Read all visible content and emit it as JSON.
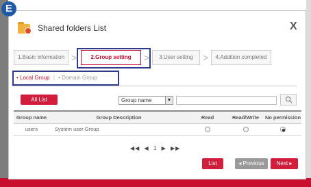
{
  "badge": "E",
  "dialog": {
    "title": "Shared folders List",
    "close": "X"
  },
  "steps": [
    {
      "label": "1.Basic information"
    },
    {
      "label": "2.Group setting"
    },
    {
      "label": "3.User setting"
    },
    {
      "label": "4.Addition completed"
    }
  ],
  "group_tabs": {
    "local": "• Local Group",
    "separator": "|",
    "domain": "• Domain Group"
  },
  "filter": {
    "all_list": "All List",
    "select_value": "Group name",
    "search_value": ""
  },
  "table": {
    "headers": [
      "Group name",
      "Group Description",
      "Read",
      "Read/Write",
      "No permission"
    ],
    "rows": [
      {
        "name": "users",
        "description": "System user Group",
        "selected": "No permission"
      }
    ]
  },
  "pager": {
    "first": "◀◀",
    "prev": "◀",
    "page": "1",
    "next": "▶",
    "last": "▶▶"
  },
  "buttons": {
    "list": "List",
    "previous": "◂ Previous",
    "next": "Next ▸"
  },
  "colors": {
    "accent": "#c8102e",
    "highlight_border": "#2e3a8c"
  }
}
